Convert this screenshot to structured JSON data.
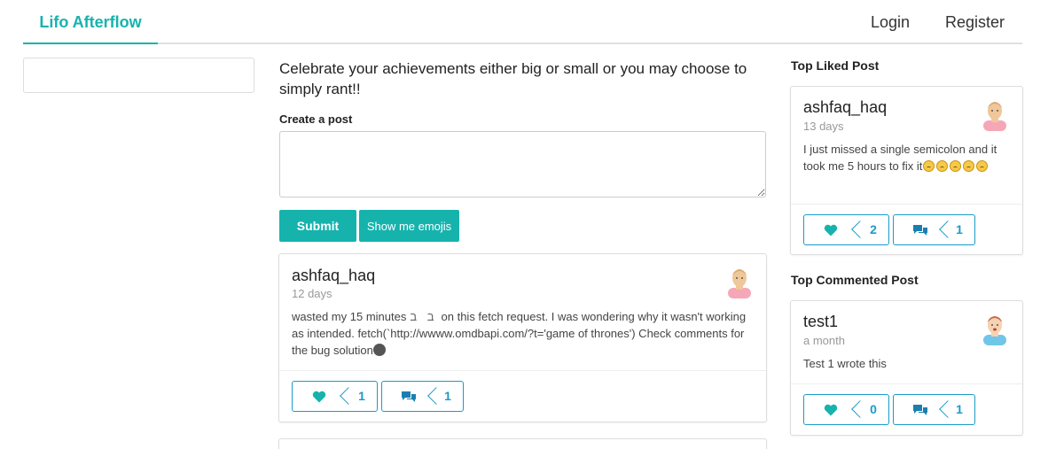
{
  "nav": {
    "brand": "Lifo Afterflow",
    "login": "Login",
    "register": "Register"
  },
  "main": {
    "headline": "Celebrate your achievements either big or small or you may choose to simply rant!!",
    "create_label": "Create a post",
    "textarea_value": "",
    "submit_label": "Submit",
    "emojis_label": "Show me emojis"
  },
  "feed": [
    {
      "user": "ashfaq_haq",
      "time": "12 days",
      "text_before": "wasted my 15 minutes",
      "kaomoji": "ב ב",
      "text_after": "on this fetch request. I was wondering why it wasn't working as intended. fetch(`http://wwww.omdbapi.com/?t='game of thrones') Check comments for the bug solution",
      "likes": "1",
      "comments": "1"
    }
  ],
  "sidebar": {
    "top_liked_title": "Top Liked Post",
    "top_liked": {
      "user": "ashfaq_haq",
      "time": "13 days",
      "text": "I just missed a single semicolon and it took me 5 hours to fix it",
      "likes": "2",
      "comments": "1"
    },
    "top_commented_title": "Top Commented Post",
    "top_commented": {
      "user": "test1",
      "time": "a month",
      "text": "Test 1 wrote this",
      "likes": "0",
      "comments": "1"
    }
  },
  "colors": {
    "accent": "#16b3ad",
    "action_blue": "#1a9bc9"
  },
  "icons": {
    "like": "heart-icon",
    "comment": "comments-icon"
  }
}
